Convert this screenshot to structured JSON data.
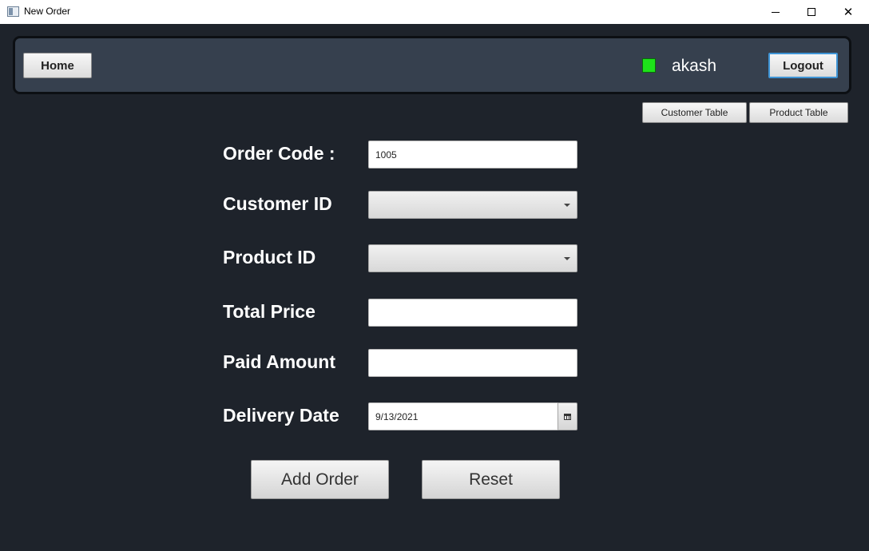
{
  "window": {
    "title": "New Order",
    "controls": {
      "minimize": "minimize-icon",
      "maximize": "maximize-icon",
      "close": "close-icon"
    }
  },
  "header": {
    "home_label": "Home",
    "status_color": "#1ee31a",
    "username": "akash",
    "logout_label": "Logout"
  },
  "toolbar": {
    "customer_table_label": "Customer Table",
    "product_table_label": "Product Table"
  },
  "form": {
    "order_code": {
      "label": "Order Code :",
      "value": "1005"
    },
    "customer_id": {
      "label": "Customer ID",
      "value": ""
    },
    "product_id": {
      "label": "Product ID",
      "value": ""
    },
    "total_price": {
      "label": "Total Price",
      "value": ""
    },
    "paid_amount": {
      "label": "Paid Amount",
      "value": ""
    },
    "delivery_date": {
      "label": "Delivery Date",
      "value": "9/13/2021"
    }
  },
  "actions": {
    "add_label": "Add Order",
    "reset_label": "Reset"
  },
  "colors": {
    "background": "#1e232b",
    "header_panel": "#36404e",
    "status_indicator": "#1ee31a",
    "logout_focus": "#3f95d6"
  }
}
